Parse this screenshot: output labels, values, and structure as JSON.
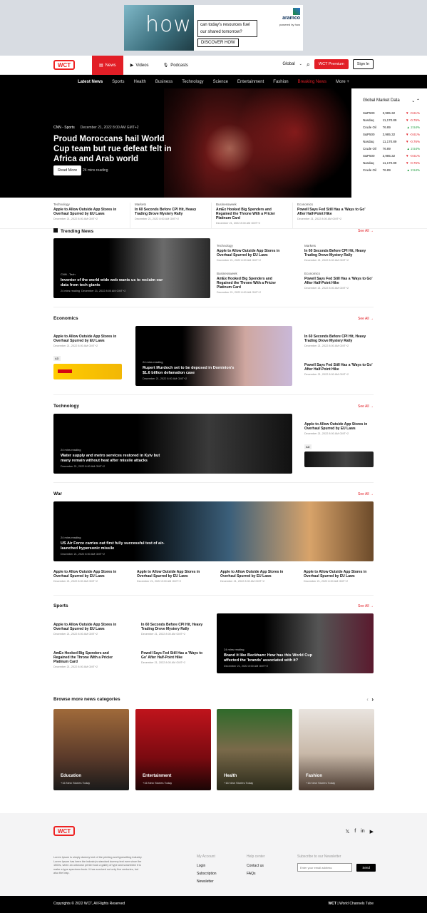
{
  "ad_top": {
    "word": "how",
    "copy": "can today's resources fuel our shared tomorrow?",
    "cta": "DISCOVER HOW",
    "brand": "aramco",
    "powered": "powered by how"
  },
  "nav": {
    "logo": "WCT",
    "tabs": [
      "News",
      "Videos",
      "Podcasts"
    ],
    "region": "Global",
    "premium": "WCT Premium",
    "signin": "Sign In"
  },
  "categories": [
    "Latest News",
    "Sports",
    "Health",
    "Business",
    "Technology",
    "Science",
    "Entertainment",
    "Fashion",
    "Breaking News",
    "More +"
  ],
  "hero": {
    "source": "CNN - Sports",
    "date": "December 21, 2022",
    "time": "8:00 AM GMT+2",
    "title": "Proud Moroccans hail World Cup team but rue defeat felt in Africa and Arab world",
    "read_more": "Read More",
    "mins": "24 mins reading"
  },
  "market": {
    "title": "Global Market Data",
    "rows": [
      {
        "name": "S&P500",
        "value": "3,985.32",
        "change": "-0.61%",
        "dir": "down"
      },
      {
        "name": "Nasdaq",
        "value": "11,170.89",
        "change": "-0.76%",
        "dir": "down"
      },
      {
        "name": "Crude Oil",
        "value": "76.89",
        "change": "2.54%",
        "dir": "up"
      },
      {
        "name": "S&P500",
        "value": "3,985.32",
        "change": "-0.61%",
        "dir": "down"
      },
      {
        "name": "Nasdaq",
        "value": "11,170.89",
        "change": "-0.76%",
        "dir": "down"
      },
      {
        "name": "Crude Oil",
        "value": "76.89",
        "change": "2.54%",
        "dir": "up"
      },
      {
        "name": "S&P500",
        "value": "3,985.32",
        "change": "-0.61%",
        "dir": "down"
      },
      {
        "name": "Nasdaq",
        "value": "11,170.89",
        "change": "-0.76%",
        "dir": "down"
      },
      {
        "name": "Crude Oil",
        "value": "76.89",
        "change": "2.54%",
        "dir": "up"
      }
    ]
  },
  "strip": [
    {
      "k": "Technology",
      "t": "Apple to Allow Outside App Stores in Overhaul Spurred by EU Laws",
      "d": "December 21, 2022  8:00 AM GMT+2"
    },
    {
      "k": "Markets",
      "t": "In 60 Seconds Before CPI Hit, Heavy Trading Drove Mystery Rally",
      "d": "December 21, 2022  8:00 AM GMT+2"
    },
    {
      "k": "Businessweek",
      "t": "AmEx Hooked Big Spenders and Regained the Throne With a Pricier Platinum Card",
      "d": "December 21, 2022  8:00 AM GMT+2"
    },
    {
      "k": "Economics",
      "t": "Powell Says Fed Still Has a 'Ways to Go' After Half-Point Hike",
      "d": "December 21, 2022  8:00 AM GMT+2"
    }
  ],
  "see_all": "See All",
  "trending": {
    "title": "Trending News",
    "main": {
      "src": "CNN - Tech",
      "title": "Inventor of the world wide web wants us to reclaim our data from tech giants",
      "mins": "24 mins reading",
      "date": "December 21, 2022  8:00 AM GMT+2"
    },
    "items": [
      {
        "k": "Technology",
        "t": "Apple to Allow Outside App Stores in Overhaul Spurred by EU Laws",
        "d": "December 21, 2022  8:00 AM GMT+2"
      },
      {
        "k": "Markets",
        "t": "In 60 Seconds Before CPI Hit, Heavy Trading Drove Mystery Rally",
        "d": "December 21, 2022  8:00 AM GMT+2"
      },
      {
        "k": "Businessweek",
        "t": "AmEx Hooked Big Spenders and Regained the Throne With a Pricier Platinum Card",
        "d": "December 21, 2022  8:00 AM GMT+2"
      },
      {
        "k": "Economics",
        "t": "Powell Says Fed Still Has a 'Ways to Go' After Half-Point Hike",
        "d": "December 21, 2022  8:00 AM GMT+2"
      }
    ]
  },
  "economics": {
    "title": "Economics",
    "left": {
      "t": "Apple to Allow Outside App Stores in Overhaul Spurred by EU Laws",
      "d": "December 21, 2022  8:00 AM GMT+2"
    },
    "ad": "AD",
    "main": {
      "mins": "24 mins reading",
      "title": "Rupert Murdoch set to be deposed in Dominion's $1.6 billion defamation case",
      "date": "December 21, 2022  8:00 AM GMT+2"
    },
    "right": [
      {
        "t": "In 60 Seconds Before CPI Hit, Heavy Trading Drove Mystery Rally",
        "d": "December 21, 2022  8:00 AM GMT+2"
      },
      {
        "t": "Powell Says Fed Still Has a 'Ways to Go' After Half-Point Hike",
        "d": "December 21, 2022  8:00 AM GMT+2"
      }
    ]
  },
  "technology": {
    "title": "Technology",
    "main": {
      "mins": "24 mins reading",
      "title": "Water supply and metro services restored in Kyiv but many remain without heat after missile attacks",
      "date": "December 21, 2022  8:00 AM GMT+2"
    },
    "right": {
      "t": "Apple to Allow Outside App Stores in Overhaul Spurred by EU Laws",
      "d": "December 21, 2022  8:00 AM GMT+2"
    },
    "ad": "AD"
  },
  "war": {
    "title": "War",
    "main": {
      "mins": "24 mins reading",
      "title": "US Air Force carries out first fully successful test of air-launched hypersonic missile",
      "date": "December 21, 2022  8:00 AM GMT+2"
    },
    "items": [
      {
        "t": "Apple to Allow Outside App Stores in Overhaul Spurred by EU Laws",
        "d": "December 21, 2022  8:00 AM GMT+2"
      },
      {
        "t": "Apple to Allow Outside App Stores in Overhaul Spurred by EU Laws",
        "d": "December 21, 2022  8:00 AM GMT+2"
      },
      {
        "t": "Apple to Allow Outside App Stores in Overhaul Spurred by EU Laws",
        "d": "December 21, 2022  8:00 AM GMT+2"
      },
      {
        "t": "Apple to Allow Outside App Stores in Overhaul Spurred by EU Laws",
        "d": "December 21, 2022  8:00 AM GMT+2"
      }
    ]
  },
  "sports": {
    "title": "Sports",
    "items": [
      {
        "t": "Apple to Allow Outside App Stores in Overhaul Spurred by EU Laws",
        "d": "December 21, 2022  8:00 AM GMT+2"
      },
      {
        "t": "In 60 Seconds Before CPI Hit, Heavy Trading Drove Mystery Rally",
        "d": "December 21, 2022  8:00 AM GMT+2"
      },
      {
        "t": "AmEx Hooked Big Spenders and Regained the Throne With a Pricier Platinum Card",
        "d": "December 21, 2022  8:00 AM GMT+2"
      },
      {
        "t": "Powell Says Fed Still Has a 'Ways to Go' After Half-Point Hike",
        "d": "December 21, 2022  8:00 AM GMT+2"
      }
    ],
    "main": {
      "mins": "24 mins reading",
      "title": "Brand it like Beckham: How has this World Cup affected the 'brands' associated with it?",
      "date": "December 21, 2022  8:00 AM GMT+2"
    }
  },
  "browse": {
    "title": "Browse more news categories",
    "tiles": [
      {
        "label": "Education",
        "sub": "+16 New Stories Today"
      },
      {
        "label": "Entertainment",
        "sub": "+16 New Stories Today"
      },
      {
        "label": "Health",
        "sub": "+16 New Stories Today"
      },
      {
        "label": "Fashion",
        "sub": "+16 New Stories Today"
      }
    ]
  },
  "footer": {
    "about": "Lorem Ipsum is simply dummy text of the printing and typesetting industry. Lorem Ipsum has been the industry's standard dummy text ever since the 1500s, when an unknown printer took a galley of type and scrambled it to make a type specimen book. It has survived not only five centuries, but also the leap.",
    "account_title": "My Account",
    "account": [
      "Login",
      "Subscription",
      "Newsletter"
    ],
    "help_title": "Help center",
    "help": [
      "Contact us",
      "FAQs"
    ],
    "subscribe_title": "Subscribe to our Newsletter",
    "email_placeholder": "Enter your email address",
    "send": "Send",
    "copyright": "Copyrights © 2022 WCT, All Rights Reserved",
    "brand_b": "WCT",
    "brand_rest": "| World Channels Tube"
  },
  "colors": {
    "accent": "#e21e26",
    "up": "#1a9a3a"
  }
}
